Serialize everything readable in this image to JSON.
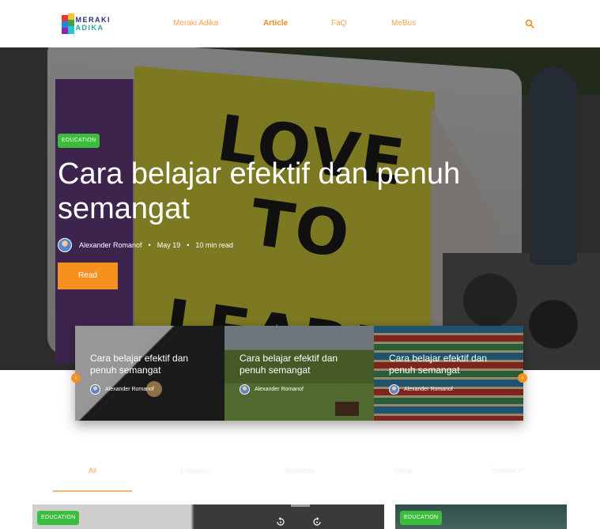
{
  "nav": {
    "logo_line1": "MERAKI",
    "logo_line2": "ADIKA",
    "links": [
      "Meraki Adika",
      "Article",
      "FaQ",
      "MeBus"
    ],
    "active_link": "Article",
    "search_icon": "search-icon",
    "accent_color": "#f08a1c"
  },
  "hero": {
    "badge": "EDUCATION",
    "title": "Cara belajar efektif dan penuh semangat",
    "author": "Alexander Romanof",
    "date": "May 19",
    "read_time": "10 min read",
    "separator": "•",
    "read_button": "Read",
    "image_lettering_line1": "LOVE TO",
    "image_lettering_line2": "LEARN",
    "button_color": "#f6901e",
    "badge_color": "#3dbd3d"
  },
  "carousel": {
    "slides": [
      {
        "title": "Cara belajar efektif dan penuh semangat",
        "author": "Alexander Romanof"
      },
      {
        "title": "Cara belajar efektif dan penuh semangat",
        "author": "Alexander Romanof"
      },
      {
        "title": "Cara belajar efektif dan penuh semangat",
        "author": "Alexander Romanof"
      }
    ],
    "prev_icon": "chevron-left-icon",
    "next_icon": "chevron-right-icon"
  },
  "filters": {
    "tabs": [
      "All",
      "Education",
      "Business",
      "Social",
      "Entertaint"
    ],
    "active": "All"
  },
  "cards": [
    {
      "badge": "EDUCATION"
    },
    {
      "badge": "EDUCATION"
    }
  ]
}
